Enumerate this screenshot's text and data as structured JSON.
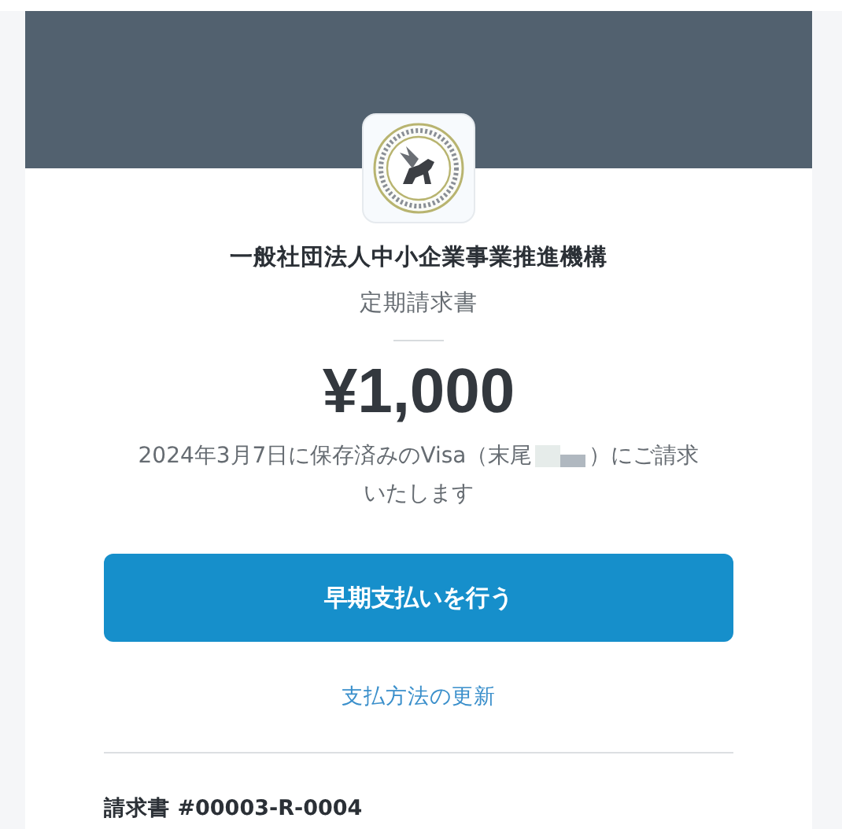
{
  "organization": "一般社団法人中小企業事業推進機構",
  "document_type": "定期請求書",
  "amount": "¥1,000",
  "charge_notice": {
    "before": "2024年3月7日に保存済みのVisa（末尾",
    "after": "）にご請求",
    "continued": "いたします"
  },
  "pay_button": "早期支払いを行う",
  "update_link": "支払方法の更新",
  "invoice_number": "請求書 #00003-R-0004"
}
